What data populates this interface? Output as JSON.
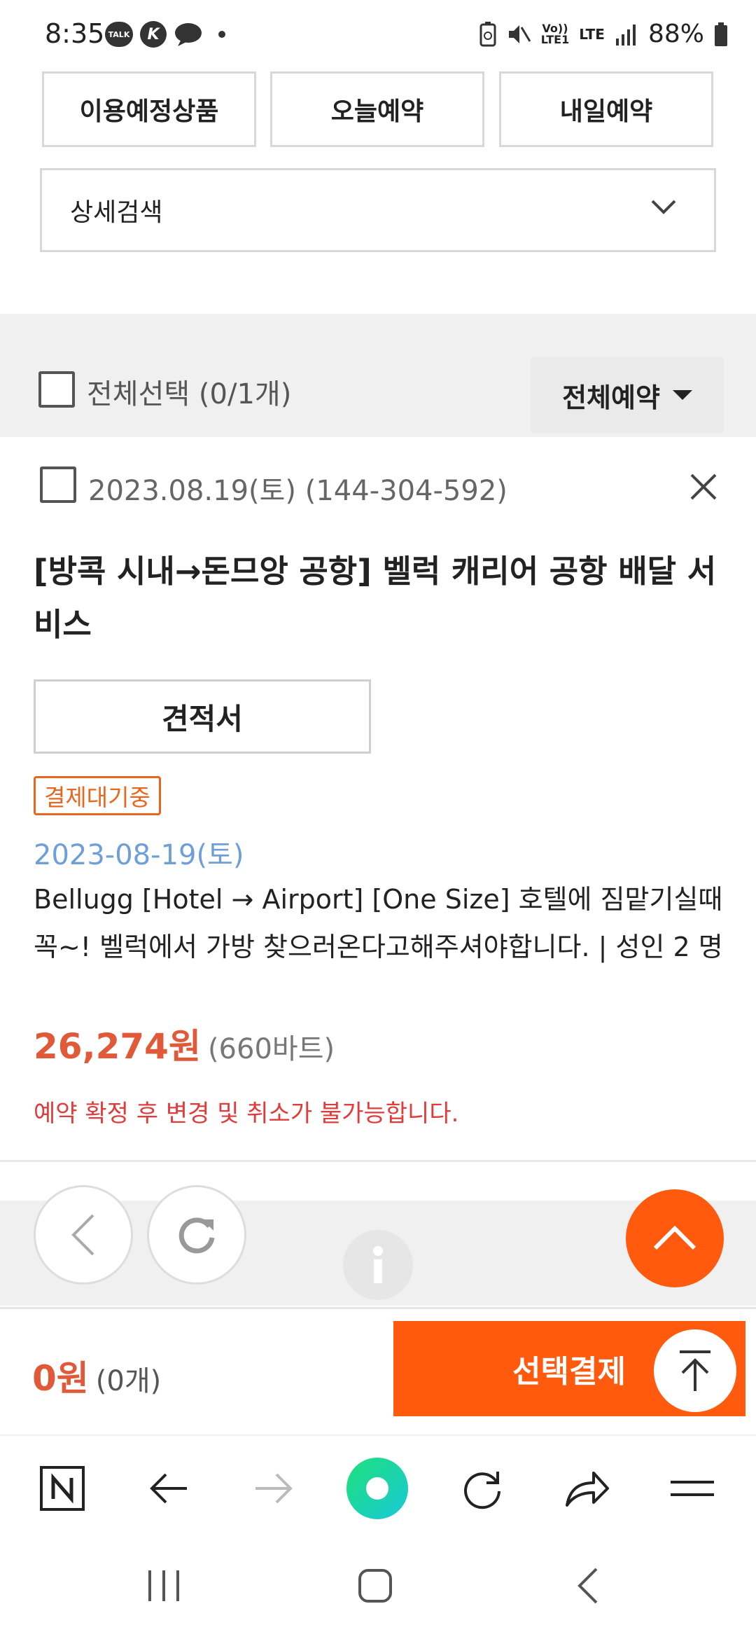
{
  "status_bar": {
    "time": "8:35",
    "notif_talk": "TALK",
    "notif_k": "K",
    "lte_label_top": "Vo))",
    "lte_label_bottom": "LTE1",
    "lte2": "LTE",
    "battery": "88%"
  },
  "filters": {
    "upcoming": "이용예정상품",
    "today": "오늘예약",
    "tomorrow": "내일예약"
  },
  "detail_search": {
    "label": "상세검색",
    "icon": "chevron-down-icon"
  },
  "select_all": {
    "label": "전체선택 (0/1개)",
    "checked": false
  },
  "reservation_filter": {
    "label": "전체예약",
    "icon": "caret-down-icon"
  },
  "item": {
    "checked": false,
    "date_code": "2023.08.19(토) (144-304-592)",
    "title": "[방콕 시내→돈므앙 공항] 벨럭 캐리어 공항 배달 서비스",
    "quote_label": "견적서",
    "status": "결제대기중",
    "usage_date": "2023-08-19(토)",
    "description": "Bellugg [Hotel → Airport] [One Size] 호텔에 짐맡기실때 꼭~! 벨럭에서 가방 찾으러온다고해주셔야합니다. | 성인 2 명",
    "price": "26,274원",
    "price_local": "(660바트)",
    "notice": "예약 확정 후 변경 및 취소가 불가능합니다."
  },
  "colors": {
    "accent": "#ff5a0e",
    "price": "#e05a3a",
    "status": "#e8671e",
    "date": "#6e9fd8",
    "notice": "#e03c3c"
  },
  "checkout": {
    "total": "0원",
    "count": "(0개)",
    "pay_label": "선택결제"
  },
  "browser_toolbar": {
    "icons": [
      "naver-n-icon",
      "back-arrow-icon",
      "forward-arrow-icon",
      "green-dot-icon",
      "reload-icon",
      "share-icon",
      "menu-icon"
    ]
  },
  "system_nav": {
    "icons": [
      "recent-apps-icon",
      "home-icon",
      "back-icon"
    ]
  }
}
